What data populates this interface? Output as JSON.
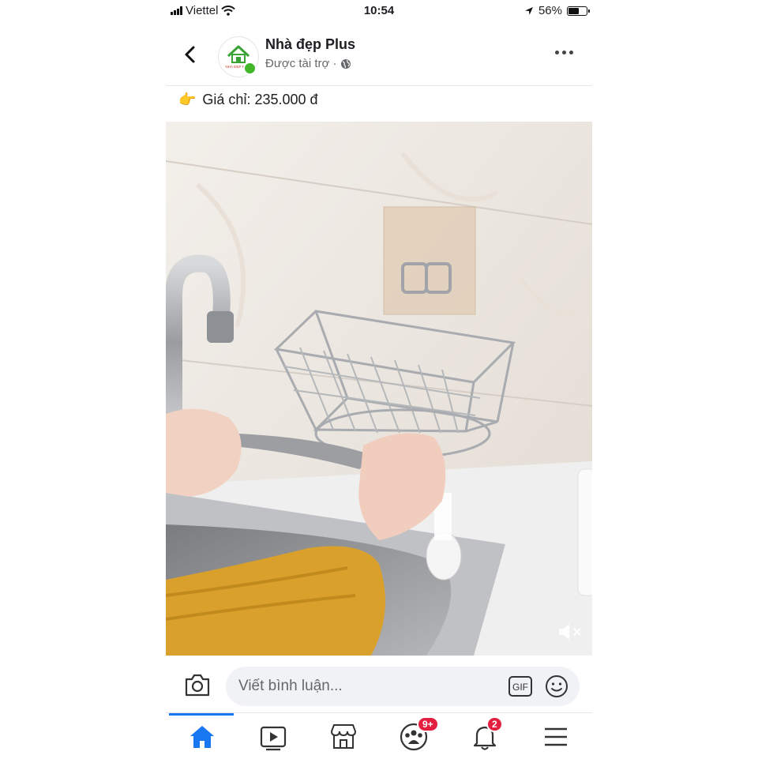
{
  "status_bar": {
    "carrier": "Viettel",
    "time": "10:54",
    "battery_percent_label": "56%",
    "battery_level": 0.56
  },
  "header": {
    "page_name": "Nhà đẹp Plus",
    "avatar_text": "NHÀ ĐẸP PLUS",
    "sponsored_label": "Được tài trợ ·",
    "icons": {
      "back": "chevron-left-icon",
      "audience": "globe-icon",
      "more": "more-dots-icon"
    }
  },
  "post": {
    "pointer_emoji": "👉",
    "text": "Giá chỉ: 235.000 đ"
  },
  "comment_bar": {
    "placeholder": "Viết bình luận...",
    "gif_label": "GIF",
    "icons": {
      "camera": "camera-icon",
      "emoji": "smiley-icon"
    }
  },
  "nav": {
    "items": [
      {
        "name": "home",
        "icon": "home-icon",
        "active": true
      },
      {
        "name": "watch",
        "icon": "video-play-icon"
      },
      {
        "name": "marketplace",
        "icon": "store-icon"
      },
      {
        "name": "groups",
        "icon": "groups-icon",
        "badge": "9+"
      },
      {
        "name": "notifications",
        "icon": "bell-icon",
        "badge": "2"
      },
      {
        "name": "menu",
        "icon": "hamburger-menu-icon"
      }
    ]
  },
  "colors": {
    "accent": "#1877f2",
    "badge": "#e41e3f",
    "online": "#42b72a",
    "input_bg": "#f0f2f5"
  }
}
